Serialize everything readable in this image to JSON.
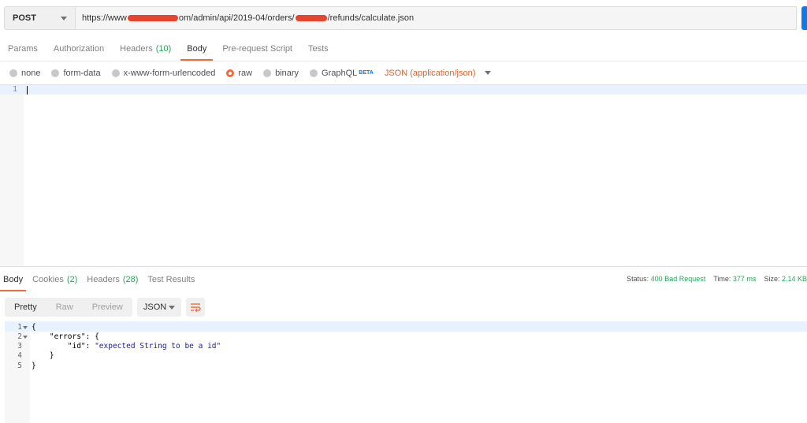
{
  "request": {
    "method": "POST",
    "url_start": "https://www",
    "url_mid": "om/admin/api/2019-04/orders/",
    "url_end": "/refunds/calculate.json"
  },
  "request_tabs": [
    {
      "label": "Params",
      "count": ""
    },
    {
      "label": "Authorization",
      "count": ""
    },
    {
      "label": "Headers",
      "count": "(10)"
    },
    {
      "label": "Body",
      "count": ""
    },
    {
      "label": "Pre-request Script",
      "count": ""
    },
    {
      "label": "Tests",
      "count": ""
    }
  ],
  "body_options": {
    "none": "none",
    "form_data": "form-data",
    "urlencoded": "x-www-form-urlencoded",
    "raw": "raw",
    "binary": "binary",
    "graphql": "GraphQL",
    "graphql_badge": "BETA",
    "content_type": "JSON (application/json)"
  },
  "request_editor": {
    "line_number": "1"
  },
  "response_tabs": [
    {
      "label": "Body",
      "count": ""
    },
    {
      "label": "Cookies",
      "count": "(2)"
    },
    {
      "label": "Headers",
      "count": "(28)"
    },
    {
      "label": "Test Results",
      "count": ""
    }
  ],
  "response_status": {
    "status_label": "Status:",
    "status_value": "400 Bad Request",
    "time_label": "Time:",
    "time_value": "377 ms",
    "size_label": "Size:",
    "size_value": "2.14 KB"
  },
  "response_toolbar": {
    "pretty": "Pretty",
    "raw": "Raw",
    "preview": "Preview",
    "format": "JSON"
  },
  "response_body": {
    "lines": [
      {
        "num": "1",
        "text": "{"
      },
      {
        "num": "2",
        "text": "    \"errors\": {"
      },
      {
        "num": "3",
        "key": "        \"id\": ",
        "value": "\"expected String to be a id\""
      },
      {
        "num": "4",
        "text": "    }"
      },
      {
        "num": "5",
        "text": "}"
      }
    ]
  },
  "colors": {
    "accent": "#f26b3a",
    "success": "#26a65b",
    "send": "#097bed",
    "json_type": "#e0622b"
  }
}
